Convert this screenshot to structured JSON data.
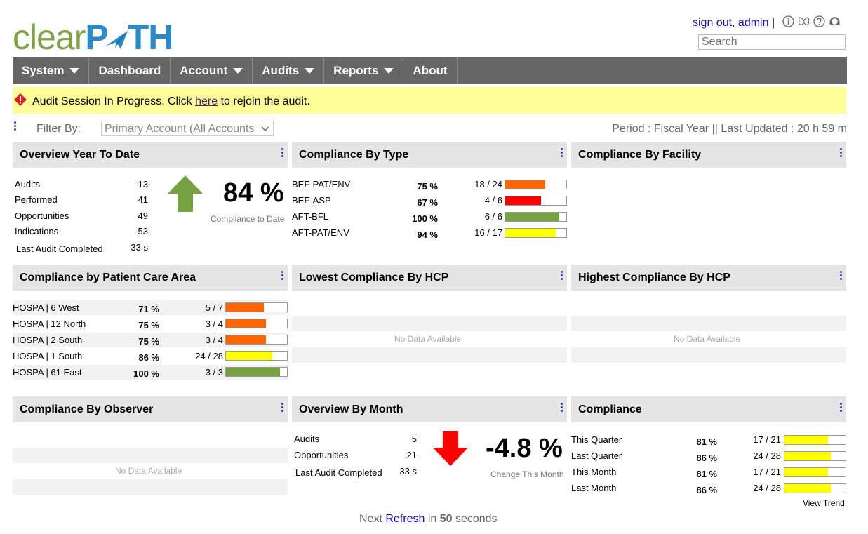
{
  "logo": {
    "part1": "clear",
    "part2": "P",
    "part3": "TH"
  },
  "header": {
    "signout": "sign out, admin",
    "separator": "|",
    "search_placeholder": "Search"
  },
  "nav": [
    "System",
    "Dashboard",
    "Account",
    "Audits",
    "Reports",
    "About"
  ],
  "alert": {
    "pre": "Audit Session In Progress. Click ",
    "link": "here",
    "post": " to rejoin the audit."
  },
  "filter": {
    "label": "Filter By:",
    "value": "Primary Account (All Accounts",
    "period": "Period : Fiscal Year || Last Updated : 20 h 59 m"
  },
  "panels": {
    "p1": "Overview Year To Date",
    "p2": "Compliance By Type",
    "p3": "Compliance By Facility",
    "p4": "Compliance by Patient Care Area",
    "p5": "Lowest Compliance By HCP",
    "p6": "Highest Compliance By HCP",
    "p7": "Compliance By Observer",
    "p8": "Overview By Month",
    "p9": "Compliance"
  },
  "overview": {
    "rows": [
      [
        "Audits",
        "13"
      ],
      [
        "Performed",
        "41"
      ],
      [
        "Opportunities",
        "49"
      ],
      [
        "Indications",
        "53"
      ],
      [
        "Last Audit Completed",
        "33 s"
      ]
    ],
    "pct": "84 %",
    "caption": "Compliance to Date"
  },
  "type_rows": [
    {
      "name": "BEF-PAT/ENV",
      "pct": "75 %",
      "ratio": "18 / 24",
      "fill": 0.75,
      "color": "#ff6600"
    },
    {
      "name": "BEF-ASP",
      "pct": "67 %",
      "ratio": "4 / 6",
      "fill": 0.67,
      "color": "#ff0000"
    },
    {
      "name": "AFT-BFL",
      "pct": "100 %",
      "ratio": "6 / 6",
      "fill": 1.0,
      "color": "#76a140"
    },
    {
      "name": "AFT-PAT/ENV",
      "pct": "94 %",
      "ratio": "16 / 17",
      "fill": 0.94,
      "color": "#ffff00"
    }
  ],
  "area_rows": [
    {
      "name": "HOSPA | 6 West",
      "pct": "71 %",
      "ratio": "5 / 7",
      "fill": 0.71,
      "color": "#ff6600"
    },
    {
      "name": "HOSPA | 12 North",
      "pct": "75 %",
      "ratio": "3 / 4",
      "fill": 0.75,
      "color": "#ff6600"
    },
    {
      "name": "HOSPA | 2 South",
      "pct": "75 %",
      "ratio": "3 / 4",
      "fill": 0.75,
      "color": "#ff6600"
    },
    {
      "name": "HOSPA | 1 South",
      "pct": "86 %",
      "ratio": "24 / 28",
      "fill": 0.86,
      "color": "#ffff00"
    },
    {
      "name": "HOSPA | 61 East",
      "pct": "100 %",
      "ratio": "3 / 3",
      "fill": 1.0,
      "color": "#76a140"
    }
  ],
  "nodata": "No Data Available",
  "month": {
    "rows": [
      [
        "Audits",
        "5"
      ],
      [
        "Opportunities",
        "21"
      ],
      [
        "Last Audit Completed",
        "33 s"
      ]
    ],
    "pct": "-4.8 %",
    "caption": "Change This Month"
  },
  "compliance_rows": [
    {
      "name": "This Quarter",
      "pct": "81 %",
      "ratio": "17 / 21",
      "fill": 0.81,
      "color": "#ffff00"
    },
    {
      "name": "Last Quarter",
      "pct": "86 %",
      "ratio": "24 / 28",
      "fill": 0.86,
      "color": "#ffff00"
    },
    {
      "name": "This Month",
      "pct": "81 %",
      "ratio": "17 / 21",
      "fill": 0.81,
      "color": "#ffff00"
    },
    {
      "name": "Last Month",
      "pct": "86 %",
      "ratio": "24 / 28",
      "fill": 0.86,
      "color": "#ffff00"
    }
  ],
  "view_trend": "View Trend",
  "footer": {
    "pre": "Next ",
    "link": "Refresh",
    "mid": " in ",
    "num": "50",
    "post": " seconds"
  }
}
